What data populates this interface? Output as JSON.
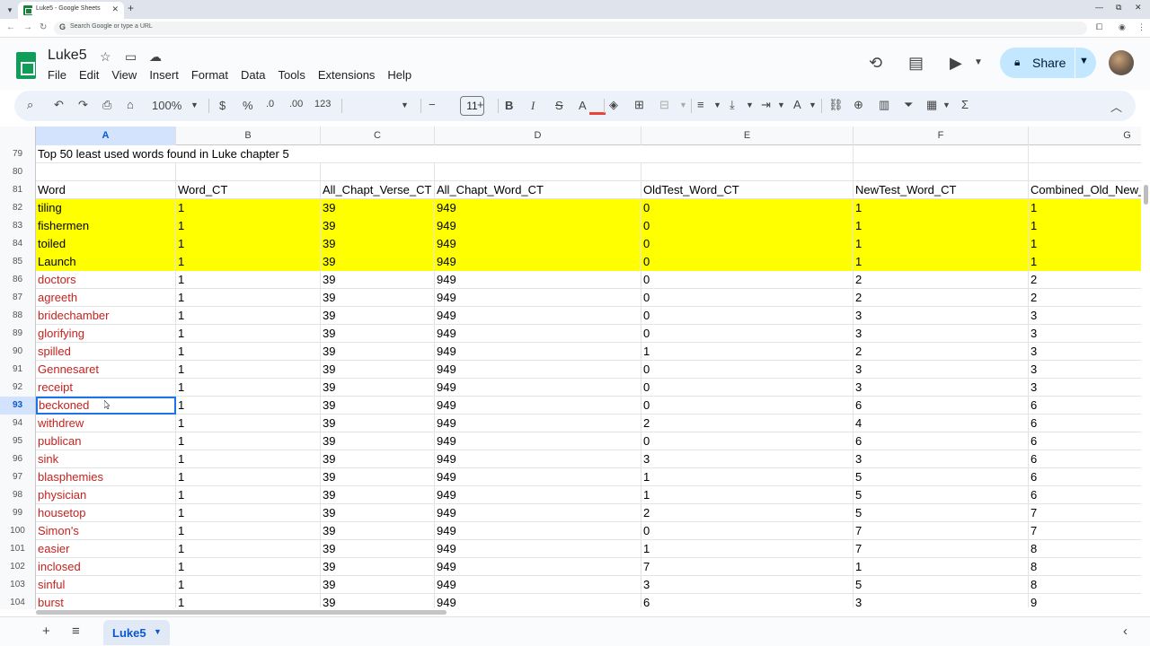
{
  "browser": {
    "tab_title": "Luke5 - Google Sheets",
    "address_placeholder": "Search Google or type a URL"
  },
  "app": {
    "doc_title": "Luke5",
    "menus": [
      "File",
      "Edit",
      "View",
      "Insert",
      "Format",
      "Data",
      "Tools",
      "Extensions",
      "Help"
    ],
    "share_label": "Share",
    "accent": "#c2e7ff"
  },
  "toolbar": {
    "zoom": "100%",
    "currency": "$",
    "percent": "%",
    "dec_decrease": ".0",
    "dec_increase": ".00",
    "number_format": "123",
    "font_size": "11",
    "bold": "B",
    "italic": "I",
    "strike": "S",
    "text_color": "A"
  },
  "grid": {
    "columns": [
      "A",
      "B",
      "C",
      "D",
      "E",
      "F",
      "G"
    ],
    "selected_column": "A",
    "selected_row": "93",
    "title_row": {
      "num": "79",
      "text": "Top 50 least used words found in Luke chapter 5"
    },
    "blank_row": {
      "num": "80"
    },
    "header_row": {
      "num": "81",
      "cells": [
        "Word",
        "Word_CT",
        "All_Chapt_Verse_CT",
        "All_Chapt_Word_CT",
        "OldTest_Word_CT",
        "NewTest_Word_CT",
        "Combined_Old_New_"
      ]
    },
    "rows": [
      {
        "num": "82",
        "cells": [
          "tiling",
          "1",
          "39",
          "949",
          "0",
          "1",
          "1"
        ],
        "yellow": true
      },
      {
        "num": "83",
        "cells": [
          "fishermen",
          "1",
          "39",
          "949",
          "0",
          "1",
          "1"
        ],
        "yellow": true
      },
      {
        "num": "84",
        "cells": [
          "toiled",
          "1",
          "39",
          "949",
          "0",
          "1",
          "1"
        ],
        "yellow": true
      },
      {
        "num": "85",
        "cells": [
          "Launch",
          "1",
          "39",
          "949",
          "0",
          "1",
          "1"
        ],
        "yellow": true
      },
      {
        "num": "86",
        "cells": [
          "doctors",
          "1",
          "39",
          "949",
          "0",
          "2",
          "2"
        ]
      },
      {
        "num": "87",
        "cells": [
          "agreeth",
          "1",
          "39",
          "949",
          "0",
          "2",
          "2"
        ]
      },
      {
        "num": "88",
        "cells": [
          "bridechamber",
          "1",
          "39",
          "949",
          "0",
          "3",
          "3"
        ]
      },
      {
        "num": "89",
        "cells": [
          "glorifying",
          "1",
          "39",
          "949",
          "0",
          "3",
          "3"
        ]
      },
      {
        "num": "90",
        "cells": [
          "spilled",
          "1",
          "39",
          "949",
          "1",
          "2",
          "3"
        ]
      },
      {
        "num": "91",
        "cells": [
          "Gennesaret",
          "1",
          "39",
          "949",
          "0",
          "3",
          "3"
        ]
      },
      {
        "num": "92",
        "cells": [
          "receipt",
          "1",
          "39",
          "949",
          "0",
          "3",
          "3"
        ]
      },
      {
        "num": "93",
        "cells": [
          "beckoned",
          "1",
          "39",
          "949",
          "0",
          "6",
          "6"
        ],
        "active": true
      },
      {
        "num": "94",
        "cells": [
          "withdrew",
          "1",
          "39",
          "949",
          "2",
          "4",
          "6"
        ]
      },
      {
        "num": "95",
        "cells": [
          "publican",
          "1",
          "39",
          "949",
          "0",
          "6",
          "6"
        ]
      },
      {
        "num": "96",
        "cells": [
          "sink",
          "1",
          "39",
          "949",
          "3",
          "3",
          "6"
        ]
      },
      {
        "num": "97",
        "cells": [
          "blasphemies",
          "1",
          "39",
          "949",
          "1",
          "5",
          "6"
        ]
      },
      {
        "num": "98",
        "cells": [
          "physician",
          "1",
          "39",
          "949",
          "1",
          "5",
          "6"
        ]
      },
      {
        "num": "99",
        "cells": [
          "housetop",
          "1",
          "39",
          "949",
          "2",
          "5",
          "7"
        ]
      },
      {
        "num": "100",
        "cells": [
          "Simon's",
          "1",
          "39",
          "949",
          "0",
          "7",
          "7"
        ]
      },
      {
        "num": "101",
        "cells": [
          "easier",
          "1",
          "39",
          "949",
          "1",
          "7",
          "8"
        ]
      },
      {
        "num": "102",
        "cells": [
          "inclosed",
          "1",
          "39",
          "949",
          "7",
          "1",
          "8"
        ]
      },
      {
        "num": "103",
        "cells": [
          "sinful",
          "1",
          "39",
          "949",
          "3",
          "5",
          "8"
        ]
      },
      {
        "num": "104",
        "cells": [
          "burst",
          "1",
          "39",
          "949",
          "6",
          "3",
          "9"
        ]
      }
    ]
  },
  "sheets": {
    "active_tab": "Luke5"
  }
}
